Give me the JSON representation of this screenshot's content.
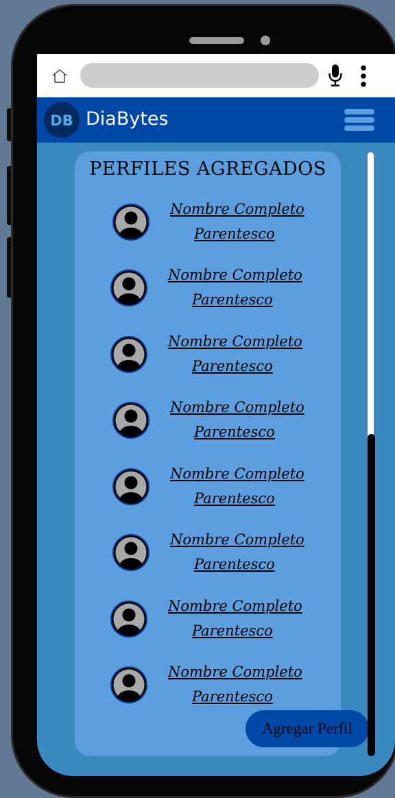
{
  "browser": {
    "home_icon": "home-icon",
    "url": "",
    "mic_icon": "microphone-icon",
    "more_icon": "vertical-dots-icon"
  },
  "header": {
    "logo_text": "DB",
    "title": "DiaBytes",
    "menu_icon": "hamburger-icon",
    "color": "#0048a8"
  },
  "card": {
    "title": "PERFILES AGREGADOS",
    "profiles": [
      {
        "name": "Nombre Completo",
        "relation": "Parentesco"
      },
      {
        "name": "Nombre Completo",
        "relation": "Parentesco"
      },
      {
        "name": "Nombre Completo",
        "relation": "Parentesco"
      },
      {
        "name": "Nombre Completo",
        "relation": "Parentesco"
      },
      {
        "name": "Nombre Completo",
        "relation": "Parentesco"
      },
      {
        "name": "Nombre Completo",
        "relation": "Parentesco"
      },
      {
        "name": "Nombre Completo",
        "relation": "Parentesco"
      },
      {
        "name": "Nombre Completo",
        "relation": "Parentesco"
      }
    ],
    "add_button": "Agregar Perfil"
  },
  "colors": {
    "screen_bg": "#3a88c0",
    "card_bg": "#5c9ede",
    "button_bg": "#0048a8"
  }
}
